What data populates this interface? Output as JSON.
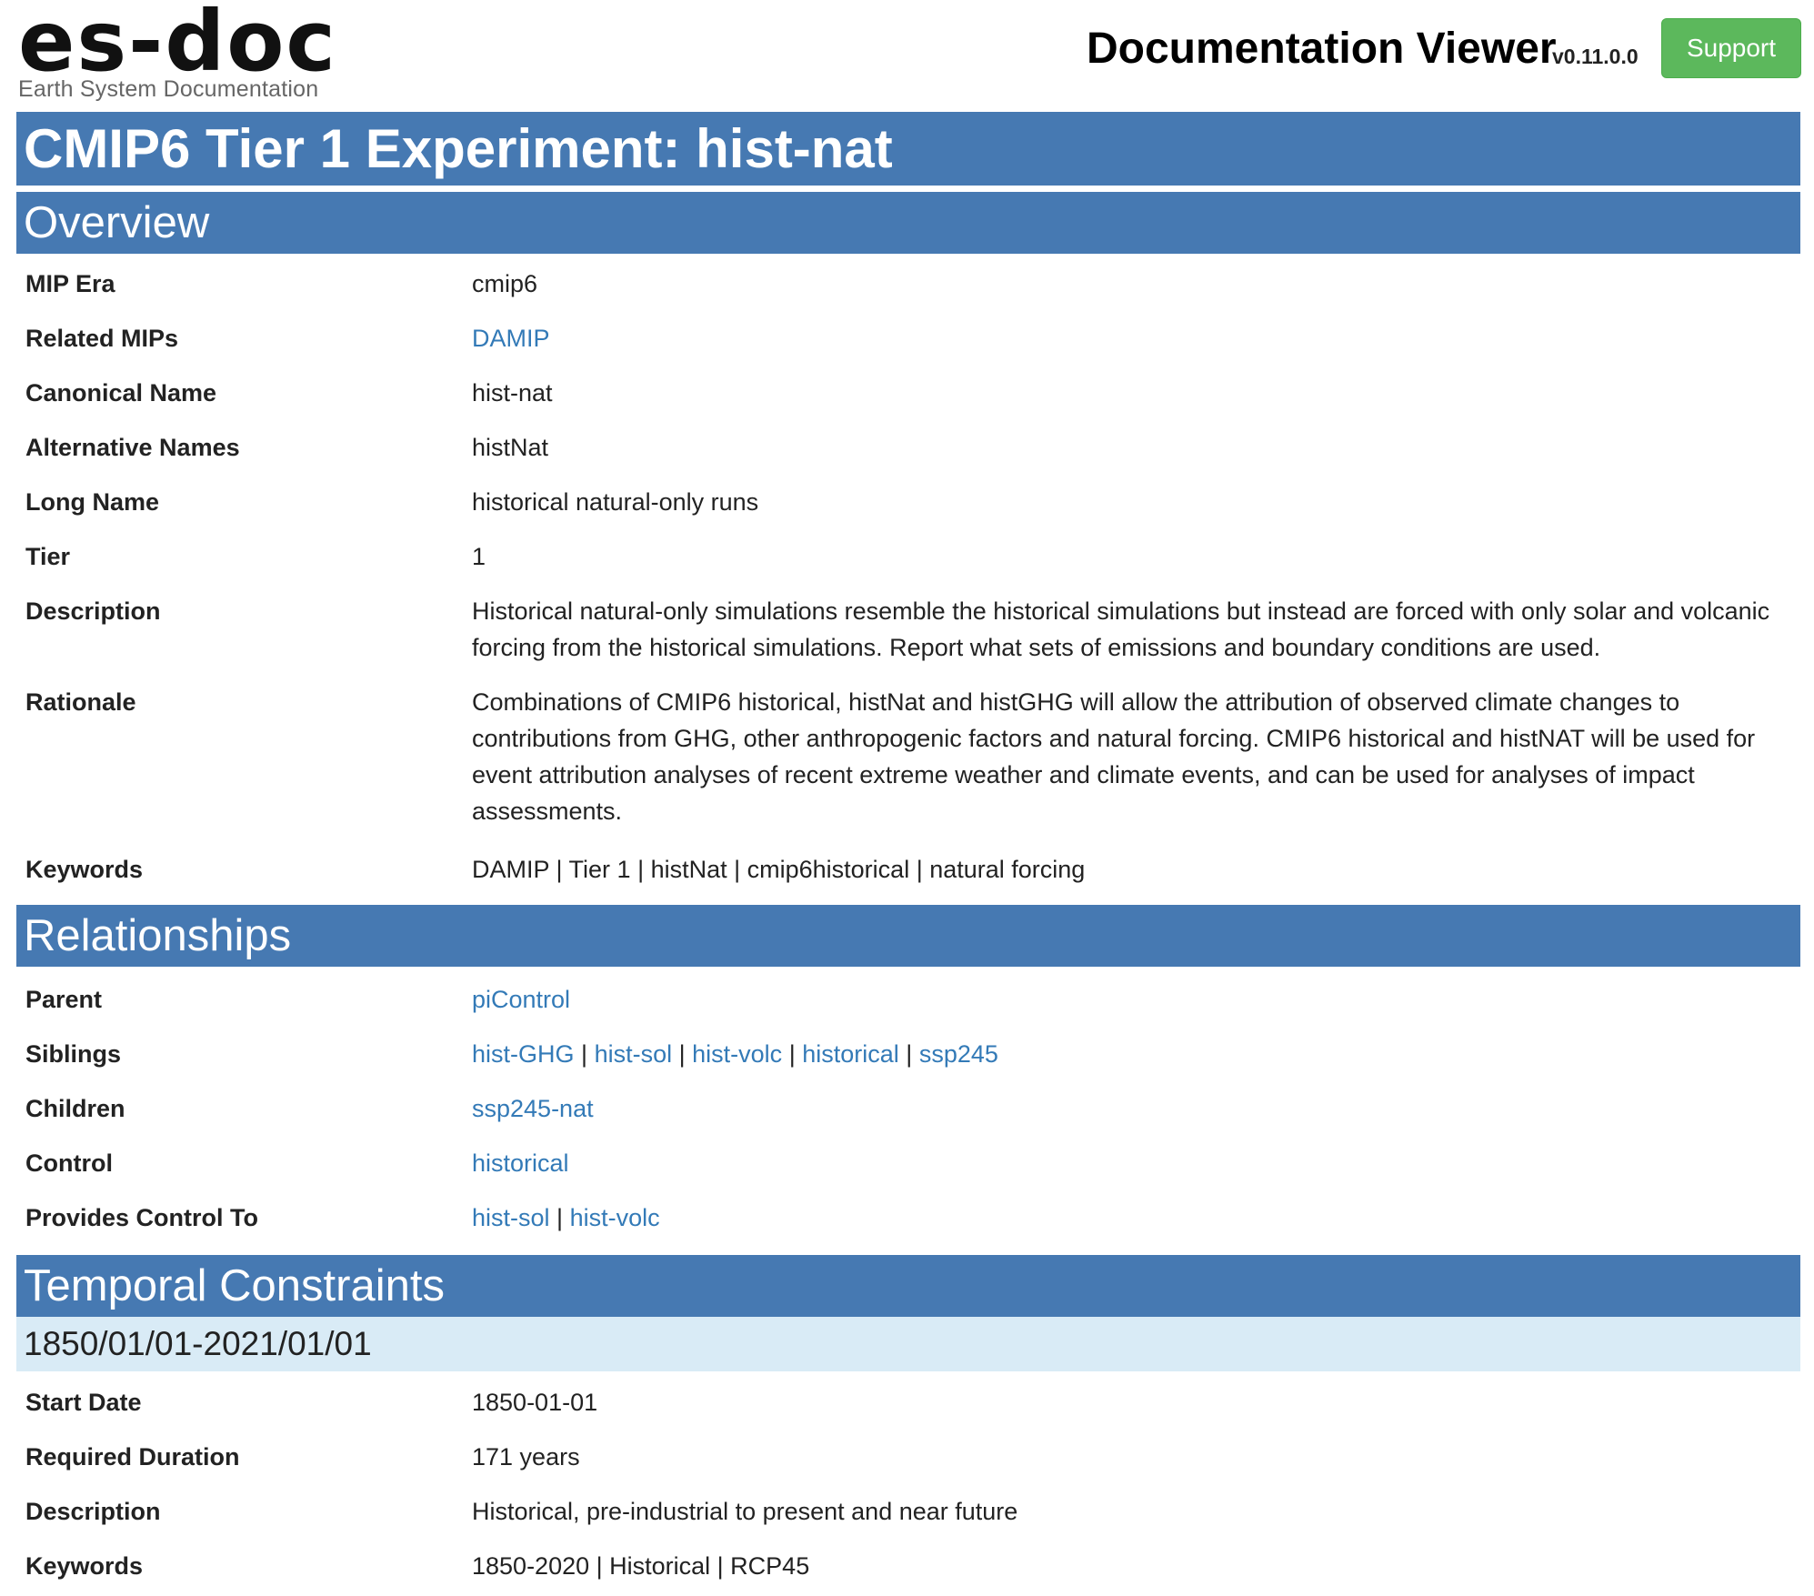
{
  "header": {
    "logo_main": "es-doc",
    "logo_sub": "Earth System Documentation",
    "viewer_title": "Documentation Viewer",
    "version": "v0.11.0.0",
    "support_label": "Support",
    "support_color": "#5cb85c"
  },
  "page_title": "CMIP6 Tier 1 Experiment: hist-nat",
  "overview": {
    "heading": "Overview",
    "mip_era": {
      "label": "MIP Era",
      "value": "cmip6"
    },
    "related_mips": {
      "label": "Related MIPs",
      "links": [
        "DAMIP"
      ]
    },
    "canonical_name": {
      "label": "Canonical Name",
      "value": "hist-nat"
    },
    "alternative_names": {
      "label": "Alternative Names",
      "value": "histNat"
    },
    "long_name": {
      "label": "Long Name",
      "value": "historical natural-only runs"
    },
    "tier": {
      "label": "Tier",
      "value": "1"
    },
    "description": {
      "label": "Description",
      "value": "Historical natural-only simulations resemble the historical simulations but instead are forced with only solar and volcanic forcing from the historical simulations. Report what sets of emissions and boundary conditions are used."
    },
    "rationale": {
      "label": "Rationale",
      "value": "Combinations of CMIP6 historical, histNat and histGHG will allow the attribution of observed climate changes to contributions from GHG, other anthropogenic factors and natural forcing. CMIP6 historical and histNAT will be used for event attribution analyses of recent extreme weather and climate events, and can be used for analyses of impact assessments."
    },
    "keywords": {
      "label": "Keywords",
      "value": "DAMIP | Tier 1 | histNat | cmip6historical | natural forcing"
    }
  },
  "relationships": {
    "heading": "Relationships",
    "parent": {
      "label": "Parent",
      "links": [
        "piControl"
      ]
    },
    "siblings": {
      "label": "Siblings",
      "links": [
        "hist-GHG",
        "hist-sol",
        "hist-volc",
        "historical",
        "ssp245"
      ]
    },
    "children": {
      "label": "Children",
      "links": [
        "ssp245-nat"
      ]
    },
    "control": {
      "label": "Control",
      "links": [
        "historical"
      ]
    },
    "provides_control_to": {
      "label": "Provides Control To",
      "links": [
        "hist-sol",
        "hist-volc"
      ]
    },
    "separator": "|"
  },
  "temporal": {
    "heading": "Temporal Constraints",
    "subheading": "1850/01/01-2021/01/01",
    "start_date": {
      "label": "Start Date",
      "value": "1850-01-01"
    },
    "required_duration": {
      "label": "Required Duration",
      "value": "171 years"
    },
    "description": {
      "label": "Description",
      "value": "Historical, pre-industrial to present and near future"
    },
    "keywords": {
      "label": "Keywords",
      "value": "1850-2020 | Historical | RCP45"
    }
  },
  "colors": {
    "section_bar": "#4679b2",
    "subsection_bar": "#d9ebf6",
    "link": "#337ab7"
  }
}
